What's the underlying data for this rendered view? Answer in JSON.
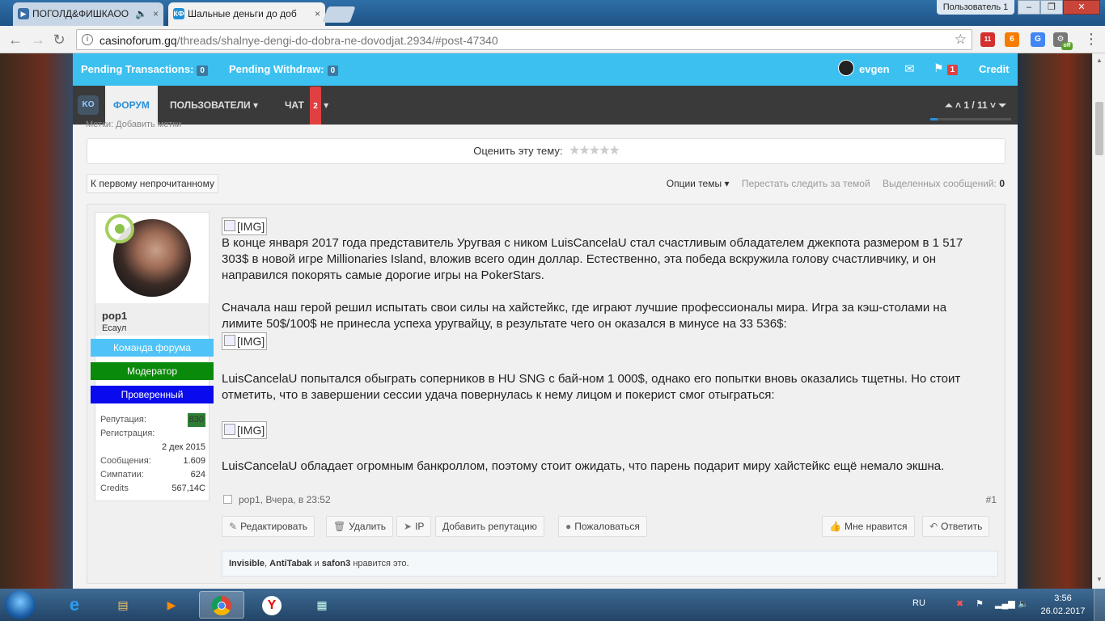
{
  "browser": {
    "tabs": [
      {
        "label": "ПОГОЛД&ФИШКАОО",
        "active": false
      },
      {
        "label": "Шальные деньги до доб",
        "active": true
      }
    ],
    "profile": "Пользователь 1",
    "window_buttons": {
      "minimize": "–",
      "maximize": "❐",
      "close": "✕"
    },
    "url_host": "casinoforum.gq",
    "url_path": "/threads/shalnye-dengi-do-dobra-ne-dovodjat.2934/#post-47340",
    "ext_badge_count": "11",
    "ext_badge_off": "off"
  },
  "topbar": {
    "pending_transactions_label": "Pending Transactions:",
    "pending_transactions_count": "0",
    "pending_withdraw_label": "Pending Withdraw:",
    "pending_withdraw_count": "0",
    "username": "evgen",
    "alerts_count": "1",
    "credit_label": "Credit"
  },
  "navbar": {
    "logo_text": "KO",
    "items": [
      {
        "label": "ФОРУМ",
        "selected": true
      },
      {
        "label": "ПОЛЬЗОВАТЕЛИ ▾",
        "selected": false
      },
      {
        "label": "ЧАТ",
        "selected": false,
        "badge": "2"
      }
    ],
    "pager": "1 / 11",
    "scroll_progress": 0.09
  },
  "thread": {
    "tags_label": "Метки: Добавить метки",
    "rate_label": "Оценить эту тему:",
    "stars": "★★★★★",
    "first_unread": "К первому непрочитанному",
    "options": "Опции темы ▾",
    "unwatch": "Перестать следить за темой",
    "selected_label": "Выделенных сообщений:",
    "selected_count": "0"
  },
  "post": {
    "user": {
      "name": "pop1",
      "rank": "Есаул",
      "ribbons": [
        {
          "label": "Команда форума",
          "color": "#4fc3f7"
        },
        {
          "label": "Модератор",
          "color": "#0a8a0a"
        },
        {
          "label": "Проверенный",
          "color": "#0a0aee"
        }
      ],
      "stats": [
        {
          "label": "Репутация:",
          "value": "830"
        },
        {
          "label": "Регистрация:",
          "value": ""
        },
        {
          "label": "",
          "value": "2 дек 2015"
        },
        {
          "label": "Сообщения:",
          "value": "1.609"
        },
        {
          "label": "Симпатии:",
          "value": "624"
        },
        {
          "label": "Credits",
          "value": "567,14C"
        }
      ]
    },
    "img_alt": "[IMG]",
    "paragraphs": [
      "В конце января 2017 года представитель Уругвая с ником LuisCancelaU стал счастливым обладателем джекпота размером в 1 517 303$ в новой игре Millionaries Island, вложив всего один доллар. Естественно, эта победа вскружила голову счастливчику, и он направился покорять самые дорогие игры на PokerStars.",
      "Сначала наш герой решил испытать свои силы на хайстейкс, где играют лучшие профессионалы мира. Игра за кэш-столами на лимите 50$/100$ не принесла успеха уругвайцу, в результате чего он оказался в минусе на 33 536$:",
      "LuisCancelaU попытался обыграть соперников в HU SNG с бай-ном 1 000$, однако его попытки вновь оказались тщетны. Но стоит отметить, что в завершении сессии удача повернулась к нему лицом и покерист смог отыграться:",
      "LuisCancelaU обладает огромным банкроллом, поэтому стоит ожидать, что парень подарит миру хайстейкс ещё немало экшна."
    ],
    "meta": "pop1, Вчера, в 23:52",
    "number": "#1",
    "actions_left": [
      {
        "icon": "✎",
        "label": "Редактировать"
      },
      {
        "icon": "🗑",
        "label": "Удалить"
      },
      {
        "icon": "➤",
        "label": "IP"
      },
      {
        "icon": "",
        "label": "Добавить репутацию"
      },
      {
        "icon": "●",
        "label": "Пожаловаться"
      }
    ],
    "actions_right": [
      {
        "icon": "👍",
        "label": "Мне нравится"
      },
      {
        "icon": "↶",
        "label": "Ответить"
      }
    ],
    "likes": {
      "users": [
        "Invisible",
        "AntiTabak",
        "safon3"
      ],
      "and_word": "и",
      "suffix": "нравится это."
    }
  },
  "taskbar": {
    "lang": "RU",
    "time": "3:56",
    "date": "26.02.2017"
  }
}
